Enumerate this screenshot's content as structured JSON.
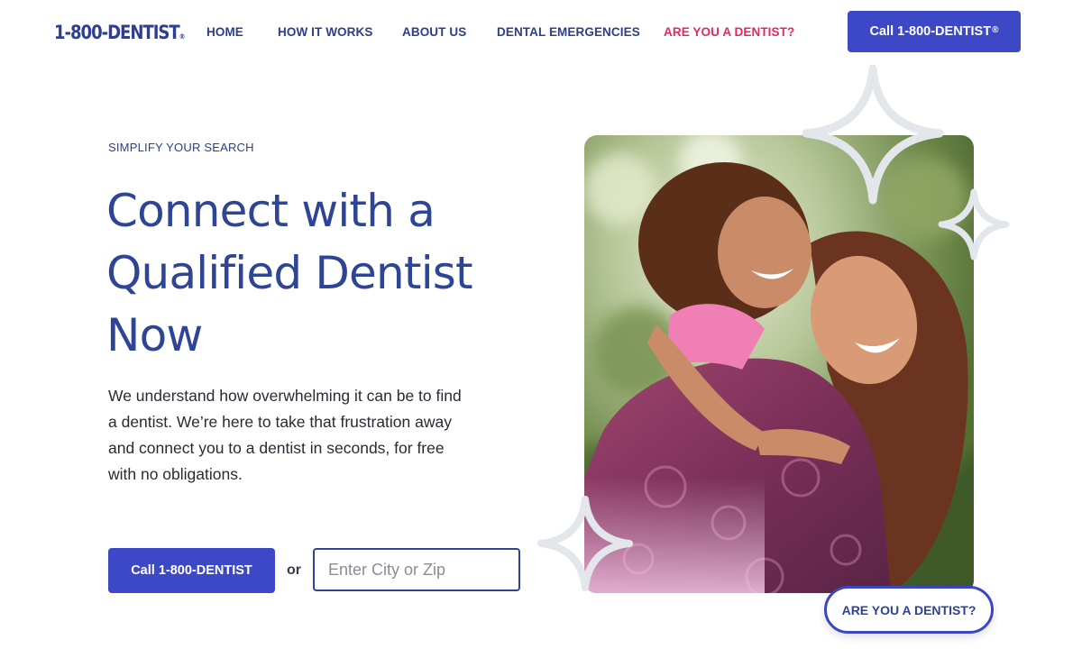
{
  "header": {
    "logo_text": "1-800-DENTIST",
    "logo_mark": "®",
    "nav": [
      {
        "label": "HOME"
      },
      {
        "label": "HOW IT WORKS"
      },
      {
        "label": "ABOUT US"
      },
      {
        "label": "DENTAL EMERGENCIES"
      },
      {
        "label": "ARE YOU A DENTIST?"
      }
    ],
    "cta_label": "Call 1-800-DENTIST",
    "cta_mark": "®"
  },
  "hero": {
    "eyebrow": "SIMPLIFY YOUR SEARCH",
    "headline_lines": [
      "Connect with a",
      "Qualified Dentist",
      "Now"
    ],
    "body": "We understand how overwhelming it can be to find a dentist. We’re here to take that frustration away and connect you to a dentist in seconds, for free with no obligations.",
    "primary_cta": "Call 1-800-DENTIST",
    "or_label": "or",
    "search": {
      "placeholder": "Enter City or Zip",
      "value": "",
      "button_icon": "search-icon"
    },
    "photo_icon": "photo-mother-daughter",
    "dentist_button": "ARE YOU A DENTIST?"
  },
  "colors": {
    "brand_blue": "#3c48c6",
    "nav_blue": "#2c3e8c",
    "headline_blue": "#2e4595",
    "accent_pink": "#e8265e",
    "sparkle_gray": "#e3e6ea"
  }
}
